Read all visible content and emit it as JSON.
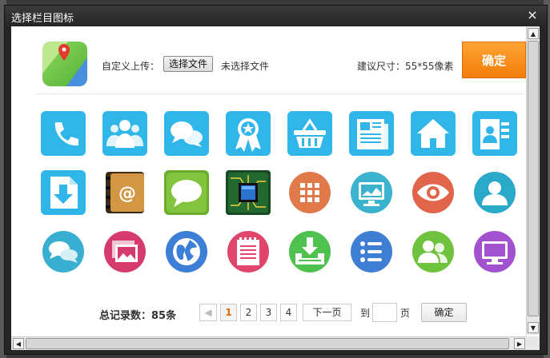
{
  "dialog": {
    "title": "选择栏目图标",
    "close_label": "×"
  },
  "upload": {
    "label": "自定义上传：",
    "file_button": "选择文件",
    "file_status": "未选择文件",
    "size_hint": "建议尺寸：55*55像素",
    "ok_button": "确定"
  },
  "icons": [
    {
      "name": "phone-icon",
      "color": "#31b6ea"
    },
    {
      "name": "team-icon",
      "color": "#31b6ea"
    },
    {
      "name": "chat-bubbles-icon",
      "color": "#31b6ea"
    },
    {
      "name": "award-badge-icon",
      "color": "#31b6ea"
    },
    {
      "name": "shopping-basket-icon",
      "color": "#31b6ea"
    },
    {
      "name": "newspaper-icon",
      "color": "#31b6ea"
    },
    {
      "name": "home-icon",
      "color": "#31b6ea"
    },
    {
      "name": "contact-card-icon",
      "color": "#31b6ea"
    },
    {
      "name": "download-file-icon",
      "color": "#31b6ea"
    },
    {
      "name": "address-book-icon",
      "color": "#c98a3a"
    },
    {
      "name": "speech-bubble-icon",
      "color": "#6aad2c"
    },
    {
      "name": "circuit-chip-icon",
      "color": "#1f5a2a"
    },
    {
      "name": "grid-apps-icon",
      "color": "#e07a4a"
    },
    {
      "name": "monitor-chart-icon",
      "color": "#3bb3cf"
    },
    {
      "name": "eye-icon",
      "color": "#e0654a"
    },
    {
      "name": "user-profile-icon",
      "color": "#2aa9c8"
    },
    {
      "name": "chat-conversation-icon",
      "color": "#39aed0"
    },
    {
      "name": "photo-gallery-icon",
      "color": "#d63b6d"
    },
    {
      "name": "globe-icon",
      "color": "#3d7ed6"
    },
    {
      "name": "notepad-icon",
      "color": "#e0456b"
    },
    {
      "name": "download-box-icon",
      "color": "#4ec14e"
    },
    {
      "name": "list-icon",
      "color": "#3e7ed4"
    },
    {
      "name": "users-icon",
      "color": "#6ec23e"
    },
    {
      "name": "computer-monitor-icon",
      "color": "#a252cf"
    }
  ],
  "pagination": {
    "total_label": "总记录数：85条",
    "prev_symbol": "◀",
    "pages": [
      "1",
      "2",
      "3",
      "4"
    ],
    "current_page": "1",
    "next_label": "下一页",
    "goto_label": "到",
    "page_label": "页",
    "goto_value": "",
    "confirm_label": "确定"
  },
  "scrollbars": {
    "up_arrow": "▲",
    "down_arrow": "▼",
    "left_arrow": "◀",
    "right_arrow": "▶"
  }
}
